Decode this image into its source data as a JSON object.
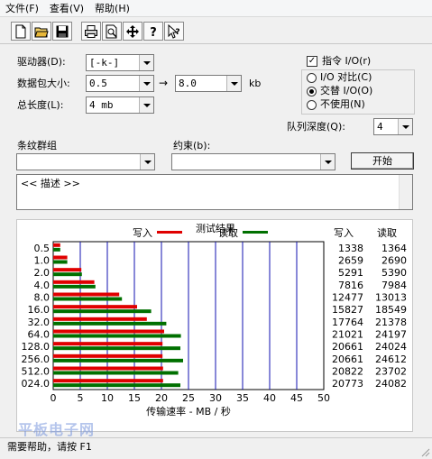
{
  "menu": [
    "文件(F)",
    "查看(V)",
    "帮助(H)"
  ],
  "toolbar_icons": [
    "new-icon",
    "open-icon",
    "save-icon",
    "print-icon",
    "print-preview-icon",
    "move-icon",
    "help-icon",
    "context-help-icon"
  ],
  "form": {
    "drive_label": "驱动器(D):",
    "drive_value": "[-k-]",
    "packet_label": "数据包大小:",
    "packet_from": "0.5",
    "packet_arrow": "→",
    "packet_to": "8.0",
    "packet_unit": "kb",
    "length_label": "总长度(L):",
    "length_value": "4 mb",
    "direct_io_label": "指令 I/O(r)",
    "direct_io_checked": true,
    "io_compare_label": "I/O 对比(C)",
    "io_overlap_label": "交替 I/O(O)",
    "io_none_label": "不使用(N)",
    "queue_label": "队列深度(Q):",
    "queue_value": "4",
    "stripe_label": "条纹群组",
    "constraint_label": "约束(b):",
    "start_button": "开始",
    "description_text": "<< 描述 >>"
  },
  "results": {
    "title": "测试结果",
    "write_col": "写入",
    "read_col": "读取"
  },
  "chart_data": {
    "type": "bar",
    "orientation": "horizontal",
    "title": "测试结果",
    "xlabel": "传输速率 - MB / 秒",
    "xlim": [
      0,
      50
    ],
    "xticks": [
      0,
      5,
      10,
      15,
      20,
      25,
      30,
      35,
      40,
      45,
      50
    ],
    "grid": true,
    "legend_placement": "top",
    "categories": [
      "0.5",
      "1.0",
      "2.0",
      "4.0",
      "8.0",
      "16.0",
      "32.0",
      "64.0",
      "128.0",
      "256.0",
      "512.0",
      "024.0"
    ],
    "series": [
      {
        "name": "写入",
        "color": "#e00000",
        "values": [
          1.3,
          2.6,
          5.2,
          7.6,
          12.2,
          15.5,
          17.3,
          20.5,
          20.2,
          20.2,
          20.3,
          20.3
        ],
        "labels": [
          "1338",
          "2659",
          "5291",
          "7816",
          "12477",
          "15827",
          "17764",
          "21021",
          "20661",
          "20661",
          "20822",
          "20773"
        ]
      },
      {
        "name": "读取",
        "color": "#007000",
        "values": [
          1.3,
          2.6,
          5.3,
          7.8,
          12.7,
          18.1,
          20.9,
          23.6,
          23.5,
          24.0,
          23.1,
          23.5
        ],
        "labels": [
          "1364",
          "2690",
          "5390",
          "7984",
          "13013",
          "18549",
          "21378",
          "24197",
          "24024",
          "24612",
          "23702",
          "24082"
        ]
      }
    ]
  },
  "status_text": "需要帮助，请按 F1",
  "watermark": "平板电子网"
}
